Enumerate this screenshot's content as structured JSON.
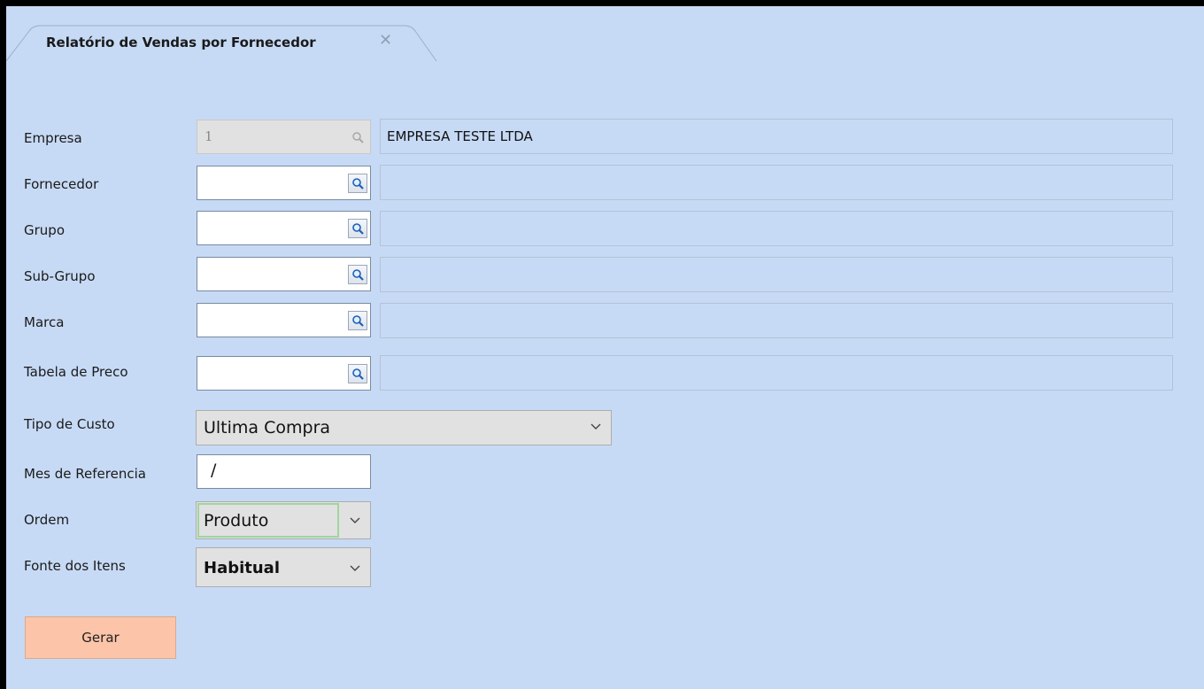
{
  "tab": {
    "title": "Relatório de Vendas por Fornecedor",
    "close_glyph": "✕"
  },
  "form": {
    "empresa": {
      "label": "Empresa",
      "code": "1",
      "description": "EMPRESA TESTE LTDA"
    },
    "fornecedor": {
      "label": "Fornecedor",
      "code": "",
      "description": ""
    },
    "grupo": {
      "label": "Grupo",
      "code": "",
      "description": ""
    },
    "subgrupo": {
      "label": "Sub-Grupo",
      "code": "",
      "description": ""
    },
    "marca": {
      "label": "Marca",
      "code": "",
      "description": ""
    },
    "tabela_preco": {
      "label": "Tabela de Preco",
      "code": "",
      "description": ""
    },
    "tipo_custo": {
      "label": "Tipo de Custo",
      "value": "Ultima Compra"
    },
    "mes_referencia": {
      "label": "Mes de Referencia",
      "value": "/"
    },
    "ordem": {
      "label": "Ordem",
      "value": "Produto"
    },
    "fonte_itens": {
      "label": "Fonte dos Itens",
      "value": "Habitual"
    }
  },
  "actions": {
    "gerar_label": "Gerar"
  },
  "colors": {
    "background": "#c7daf5",
    "button_gerar": "#fcc4a8",
    "focus_border": "#9ed69e"
  },
  "icons": {
    "lookup": "magnifier-icon",
    "dropdown": "chevron-down-icon",
    "close": "close-icon"
  }
}
